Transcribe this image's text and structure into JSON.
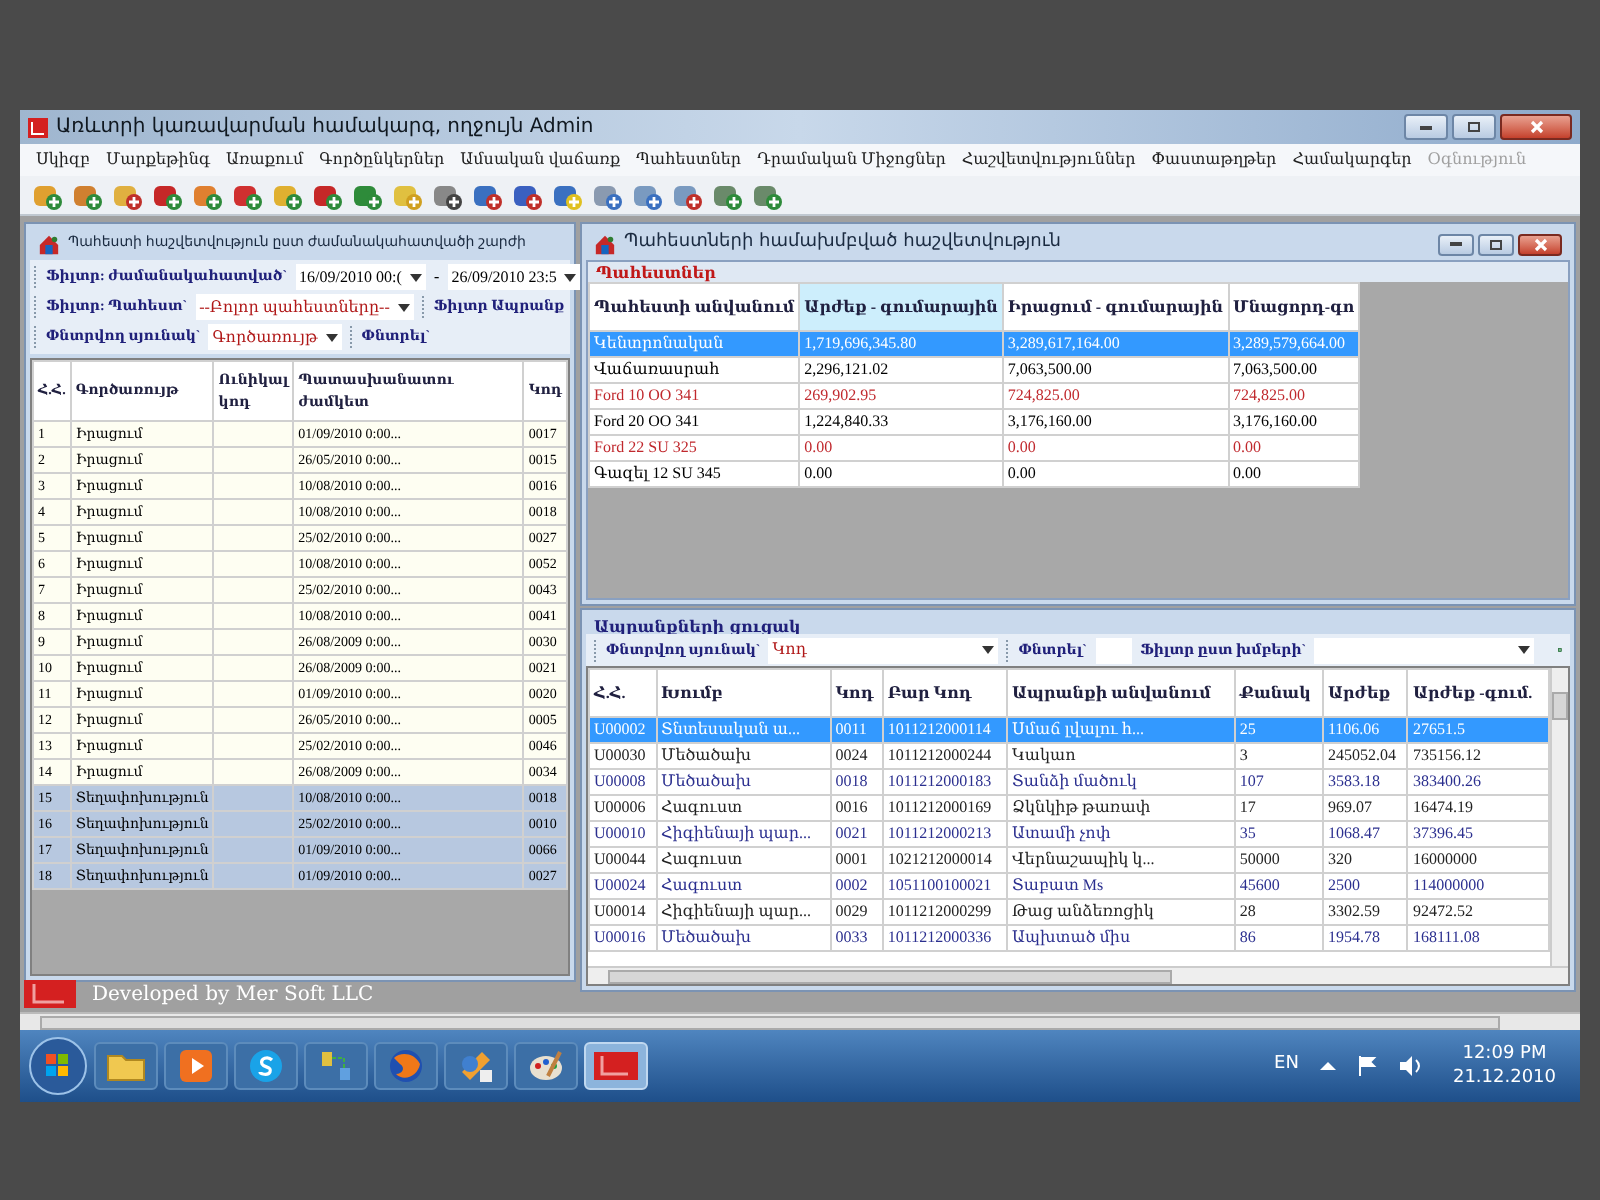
{
  "window": {
    "title": "Առևտրի կառավարման համակարգ, ողջույն",
    "user": "Admin"
  },
  "menu": [
    {
      "label": "Սկիզբ",
      "disabled": false
    },
    {
      "label": "Մարքեթինգ",
      "disabled": false
    },
    {
      "label": "Առաքում",
      "disabled": false
    },
    {
      "label": "Գործընկերներ",
      "disabled": false
    },
    {
      "label": "Ամսական վաճառք",
      "disabled": false
    },
    {
      "label": "Պահեստներ",
      "disabled": false
    },
    {
      "label": "Դրամական Միջոցներ",
      "disabled": false
    },
    {
      "label": "Հաշվետվություններ",
      "disabled": false
    },
    {
      "label": "Փաստաթղթեր",
      "disabled": false
    },
    {
      "label": "Համակարգեր",
      "disabled": false
    },
    {
      "label": "Օգնություն",
      "disabled": true
    }
  ],
  "period_report": {
    "title": "Պահեստի հաշվետվություն ըստ ժամանակահատվածի շարժի",
    "period_filter": {
      "label": "Ֆիլտր: ժամանակահատված`",
      "from": "16/09/2010 00:(",
      "separator": "-",
      "to": "26/09/2010 23:5"
    },
    "store_filter": {
      "label": "Ֆիլտր: Պահեստ`",
      "value": "--Բոլոր պահեստները--"
    },
    "product_filter": {
      "label": "Ֆիլտր Ապրանք"
    },
    "search": {
      "column_label": "Փնտրվող սյունակ`",
      "column": "Գործառույթ",
      "search_label": "Փնտրել`"
    },
    "columns": [
      "Հ.Հ.",
      "Գործառույթ",
      "Ունիկալ կոդ",
      "Պատասխանատու ժամկետ",
      "Կոդ"
    ],
    "rows": [
      {
        "n": "1",
        "operation": "Իրացում",
        "date": "01/09/2010 0:00...",
        "code": "0017",
        "selected": false
      },
      {
        "n": "2",
        "operation": "Իրացում",
        "date": "26/05/2010 0:00...",
        "code": "0015",
        "selected": false
      },
      {
        "n": "3",
        "operation": "Իրացում",
        "date": "10/08/2010 0:00...",
        "code": "0016",
        "selected": false
      },
      {
        "n": "4",
        "operation": "Իրացում",
        "date": "10/08/2010 0:00...",
        "code": "0018",
        "selected": false
      },
      {
        "n": "5",
        "operation": "Իրացում",
        "date": "25/02/2010 0:00...",
        "code": "0027",
        "selected": false
      },
      {
        "n": "6",
        "operation": "Իրացում",
        "date": "10/08/2010 0:00...",
        "code": "0052",
        "selected": false
      },
      {
        "n": "7",
        "operation": "Իրացում",
        "date": "25/02/2010 0:00...",
        "code": "0043",
        "selected": false
      },
      {
        "n": "8",
        "operation": "Իրացում",
        "date": "10/08/2010 0:00...",
        "code": "0041",
        "selected": false
      },
      {
        "n": "9",
        "operation": "Իրացում",
        "date": "26/08/2009 0:00...",
        "code": "0030",
        "selected": false
      },
      {
        "n": "10",
        "operation": "Իրացում",
        "date": "26/08/2009 0:00...",
        "code": "0021",
        "selected": false
      },
      {
        "n": "11",
        "operation": "Իրացում",
        "date": "01/09/2010 0:00...",
        "code": "0020",
        "selected": false
      },
      {
        "n": "12",
        "operation": "Իրացում",
        "date": "26/05/2010 0:00...",
        "code": "0005",
        "selected": false
      },
      {
        "n": "13",
        "operation": "Իրացում",
        "date": "25/02/2010 0:00...",
        "code": "0046",
        "selected": false
      },
      {
        "n": "14",
        "operation": "Իրացում",
        "date": "26/08/2009 0:00...",
        "code": "0034",
        "selected": false
      },
      {
        "n": "15",
        "operation": "Տեղափոխություն",
        "date": "10/08/2010 0:00...",
        "code": "0018",
        "selected": true
      },
      {
        "n": "16",
        "operation": "Տեղափոխություն",
        "date": "25/02/2010 0:00...",
        "code": "0010",
        "selected": true
      },
      {
        "n": "17",
        "operation": "Տեղափոխություն",
        "date": "01/09/2010 0:00...",
        "code": "0066",
        "selected": true
      },
      {
        "n": "18",
        "operation": "Տեղափոխություն",
        "date": "01/09/2010 0:00...",
        "code": "0027",
        "selected": true
      }
    ]
  },
  "stores_report": {
    "title": "Պահեստների համախմբված հաշվետվություն",
    "group": "Պահեստներ",
    "columns": [
      "Պահեստի անվանում",
      "Արժեք - գումարային",
      "Իրացում - գումարային",
      "Մնացորդ-գո"
    ],
    "rows": [
      {
        "cells": [
          "Կենտրոնական",
          "1,719,696,345.80",
          "3,289,617,164.00",
          "3,289,579,664.00"
        ],
        "selected": true
      },
      {
        "cells": [
          "Վաճառասրահ",
          "2,296,121.02",
          "7,063,500.00",
          "7,063,500.00"
        ],
        "color": "#000000",
        "selected": false
      },
      {
        "cells": [
          "Ford 10 OO 341",
          "269,902.95",
          "724,825.00",
          "724,825.00"
        ],
        "color": "#c0282d",
        "selected": false
      },
      {
        "cells": [
          "Ford 20 OO 341",
          "1,224,840.33",
          "3,176,160.00",
          "3,176,160.00"
        ],
        "color": "#000000",
        "selected": false
      },
      {
        "cells": [
          "Ford 22 SU 325",
          "0.00",
          "0.00",
          "0.00"
        ],
        "color": "#c0282d",
        "selected": false
      },
      {
        "cells": [
          "Գազել 12 SU 345",
          "0.00",
          "0.00",
          "0.00"
        ],
        "color": "#000000",
        "selected": false
      }
    ]
  },
  "products": {
    "group": "Ապրանքների ցուցակ",
    "search": {
      "column_label": "Փնտրվող սյունակ`",
      "column": "Կոդ",
      "search_label": "Փնտրել`",
      "group_filter_label": "Ֆիլտր ըստ խմբերի`"
    },
    "columns": [
      "Հ.Հ.",
      "Խումբ",
      "Կոդ",
      "Բար Կոդ",
      "Ապրանքի անվանում",
      "Քանակ",
      "Արժեք",
      "Արժեք -գում."
    ],
    "rows": [
      {
        "cells": [
          "U00002",
          "Տնտեսական ա...",
          "0011",
          "1011212000114",
          "Սմաճ լվալու հ...",
          "25",
          "1106.06",
          "27651.5"
        ],
        "selected": true
      },
      {
        "cells": [
          "U00030",
          "Մեծածախ",
          "0024",
          "1011212000244",
          "Կակաո",
          "3",
          "245052.04",
          "735156.12"
        ],
        "color": "#222222",
        "selected": false
      },
      {
        "cells": [
          "U00008",
          "Մեծածախ",
          "0018",
          "1011212000183",
          "Տանձի մածուկ",
          "107",
          "3583.18",
          "383400.26"
        ],
        "color": "#2b2f8f",
        "selected": false
      },
      {
        "cells": [
          "U00006",
          "Հագուստ",
          "0016",
          "1011212000169",
          "Ձկնկիթ թառափ",
          "17",
          "969.07",
          "16474.19"
        ],
        "color": "#222222",
        "selected": false
      },
      {
        "cells": [
          "U00010",
          "Հիգիենայի պար...",
          "0021",
          "1011212000213",
          "Ատամի չոփ",
          "35",
          "1068.47",
          "37396.45"
        ],
        "color": "#2b2f8f",
        "selected": false
      },
      {
        "cells": [
          "U00044",
          "Հագուստ",
          "0001",
          "1021212000014",
          "Վերնաշապիկ կ...",
          "50000",
          "320",
          "16000000"
        ],
        "color": "#222222",
        "selected": false
      },
      {
        "cells": [
          "U00024",
          "Հագուստ",
          "0002",
          "1051100100021",
          "Տաբատ Ms",
          "45600",
          "2500",
          "114000000"
        ],
        "color": "#2b2f8f",
        "selected": false
      },
      {
        "cells": [
          "U00014",
          "Հիգիենայի պար...",
          "0029",
          "1011212000299",
          "Թաց անձեռոցիկ",
          "28",
          "3302.59",
          "92472.52"
        ],
        "color": "#222222",
        "selected": false
      },
      {
        "cells": [
          "U00016",
          "Մեծածախ",
          "0033",
          "1011212000336",
          "Ապխտած միս",
          "86",
          "1954.78",
          "168111.08"
        ],
        "color": "#2b2f8f",
        "selected": false
      }
    ]
  },
  "status": {
    "text": "Developed by Mer Soft LLC"
  },
  "tray": {
    "language": "EN",
    "time": "12:09 PM",
    "date": "21.12.2010"
  }
}
